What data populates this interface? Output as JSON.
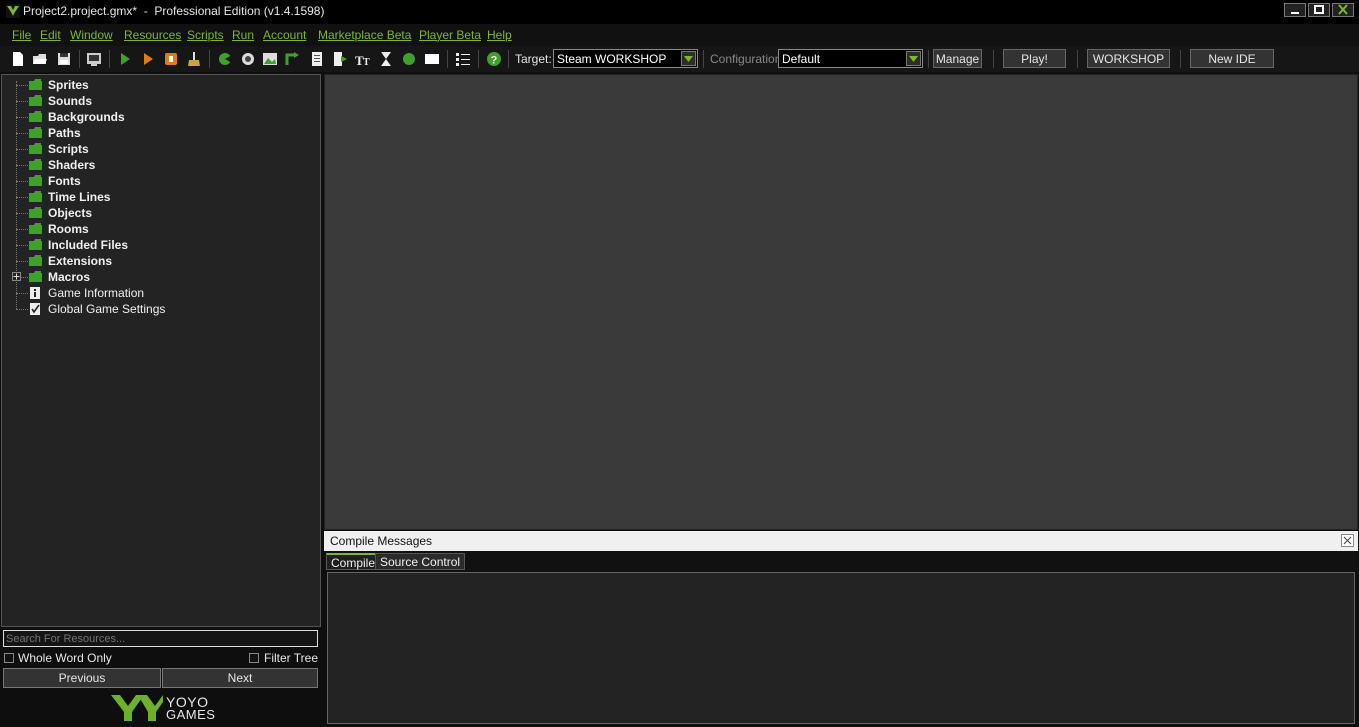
{
  "window": {
    "title": "Project2.project.gmx*  -  Professional Edition (v1.4.1598)"
  },
  "menu": {
    "items": [
      "File",
      "Edit",
      "Window",
      "Resources",
      "Scripts",
      "Run",
      "Account",
      "Marketplace Beta",
      "Player Beta",
      "Help"
    ]
  },
  "toolbar": {
    "target_label": "Target:",
    "target_value": "Steam WORKSHOP",
    "config_label": "Configuration:",
    "config_value": "Default",
    "manage_label": "Manage",
    "play_label": "Play!",
    "workshop_label": "WORKSHOP",
    "new_ide_label": "New IDE"
  },
  "tree": {
    "folders": [
      "Sprites",
      "Sounds",
      "Backgrounds",
      "Paths",
      "Scripts",
      "Shaders",
      "Fonts",
      "Time Lines",
      "Objects",
      "Rooms",
      "Included Files",
      "Extensions",
      "Macros"
    ],
    "items": [
      "Game Information",
      "Global Game Settings"
    ]
  },
  "search": {
    "placeholder": "Search For Resources...",
    "whole_word_label": "Whole Word Only",
    "filter_tree_label": "Filter Tree",
    "previous_label": "Previous",
    "next_label": "Next"
  },
  "logo": {
    "line1": "YOYO",
    "line2": "GAMES"
  },
  "compile": {
    "title": "Compile Messages",
    "tabs": [
      "Compile",
      "Source Control"
    ]
  },
  "colors": {
    "accent_green": "#7bb82a",
    "background": "#232323"
  }
}
